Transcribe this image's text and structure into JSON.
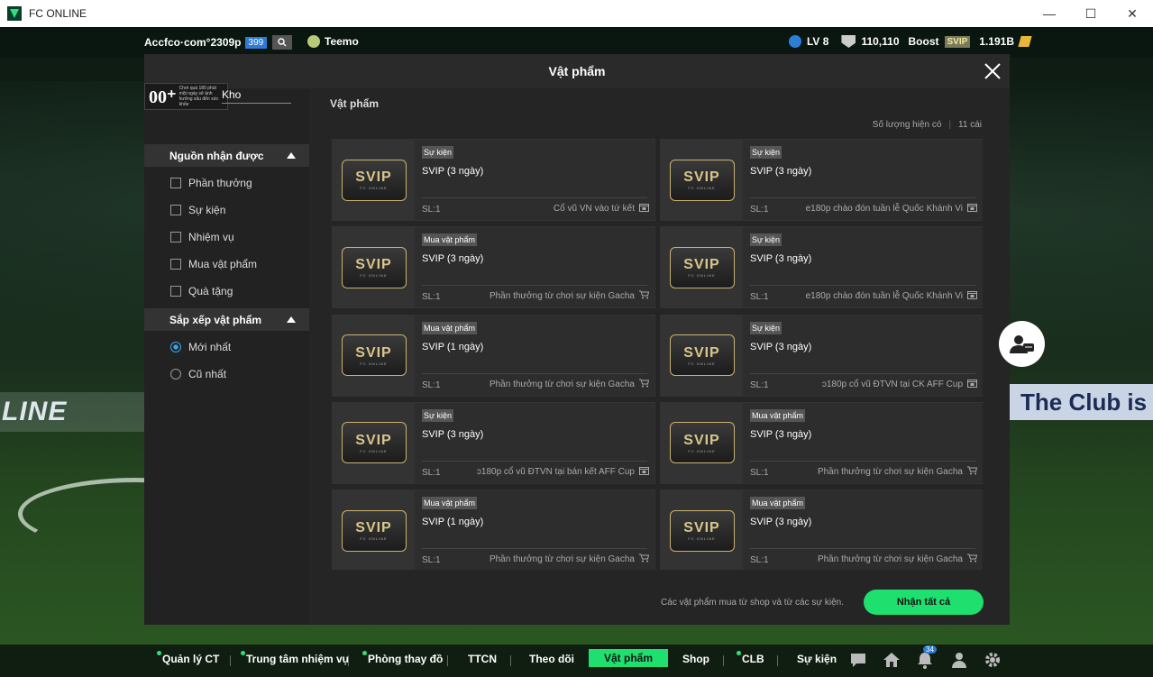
{
  "window": {
    "title": "FC ONLINE",
    "minimize": "—",
    "maximize": "☐",
    "close": "✕"
  },
  "topbar": {
    "username": "Accfco·com°2309p",
    "user_badge": "399",
    "team": "Teemo",
    "level": "LV 8",
    "ovr": "110,110",
    "boost_label": "Boost",
    "svip": "SVIP",
    "bp": "1.191B"
  },
  "background": {
    "banner_left": "LINE",
    "banner_right": "The Club is Y"
  },
  "modal": {
    "title": "Vật phẩm",
    "age_rating": "00⁺",
    "age_note": "Chơi quá 180 phút một ngày sẽ ảnh hưởng xấu đến sức khỏe",
    "storage_label": "Kho",
    "content_title": "Vật phẩm",
    "count_label": "Số lượng hiện có",
    "count_value": "11 cái",
    "source_section": "Nguồn nhận được",
    "source_filters": [
      {
        "label": "Phần thưởng",
        "checked": false
      },
      {
        "label": "Sự kiện",
        "checked": false
      },
      {
        "label": "Nhiệm vụ",
        "checked": false
      },
      {
        "label": "Mua vật phẩm",
        "checked": false
      },
      {
        "label": "Quà tặng",
        "checked": false
      }
    ],
    "sort_section": "Sắp xếp vật phẩm",
    "sort_options": [
      {
        "label": "Mới nhất",
        "selected": true
      },
      {
        "label": "Cũ nhất",
        "selected": false
      }
    ],
    "items": [
      {
        "tag": "Sự kiện",
        "name": "SVIP (3 ngày)",
        "qty": "SL:1",
        "source": "Cổ vũ VN vào tứ kết",
        "icon": "calendar-icon"
      },
      {
        "tag": "Sự kiện",
        "name": "SVIP (3 ngày)",
        "qty": "SL:1",
        "source": "e180p chào đón tuần lễ Quốc Khánh Vi",
        "icon": "calendar-icon"
      },
      {
        "tag": "Mua vật phẩm",
        "name": "SVIP (3 ngày)",
        "qty": "SL:1",
        "source": "Phần thưởng từ chơi sự kiện Gacha",
        "icon": "cart-icon"
      },
      {
        "tag": "Sự kiện",
        "name": "SVIP (3 ngày)",
        "qty": "SL:1",
        "source": "e180p chào đón tuần lễ Quốc Khánh Vi",
        "icon": "calendar-icon"
      },
      {
        "tag": "Mua vật phẩm",
        "name": "SVIP (1 ngày)",
        "qty": "SL:1",
        "source": "Phần thưởng từ chơi sự kiện Gacha",
        "icon": "cart-icon"
      },
      {
        "tag": "Sự kiện",
        "name": "SVIP (3 ngày)",
        "qty": "SL:1",
        "source": "ɔ180p cổ vũ ĐTVN tại CK AFF Cup",
        "icon": "calendar-icon"
      },
      {
        "tag": "Sự kiện",
        "name": "SVIP (3 ngày)",
        "qty": "SL:1",
        "source": "ɔ180p cổ vũ ĐTVN tại bán kết AFF Cup",
        "icon": "calendar-icon"
      },
      {
        "tag": "Mua vật phẩm",
        "name": "SVIP (3 ngày)",
        "qty": "SL:1",
        "source": "Phần thưởng từ chơi sự kiện Gacha",
        "icon": "cart-icon"
      },
      {
        "tag": "Mua vật phẩm",
        "name": "SVIP (1 ngày)",
        "qty": "SL:1",
        "source": "Phần thưởng từ chơi sự kiện Gacha",
        "icon": "cart-icon"
      },
      {
        "tag": "Mua vật phẩm",
        "name": "SVIP (3 ngày)",
        "qty": "SL:1",
        "source": "Phần thưởng từ chơi sự kiện Gacha",
        "icon": "cart-icon"
      }
    ],
    "item_logo_text": "SVIP",
    "item_logo_sub": "FC ONLINE",
    "footer_note": "Các vật phẩm mua từ shop và từ các sự kiện.",
    "claim_all": "Nhận tất cả"
  },
  "bottomnav": {
    "items": [
      {
        "label": "Quản lý CT",
        "dot": true
      },
      {
        "label": "Trung tâm nhiệm vụ",
        "dot": true
      },
      {
        "label": "Phòng thay đồ",
        "dot": true
      },
      {
        "label": "TTCN",
        "dot": false
      },
      {
        "label": "Theo dõi",
        "dot": false
      },
      {
        "label": "Vật phẩm",
        "dot": false,
        "active": true
      },
      {
        "label": "Shop",
        "dot": false
      },
      {
        "label": "CLB",
        "dot": true
      },
      {
        "label": "Sự kiện",
        "dot": false
      }
    ],
    "notification_count": "34",
    "accent": "#1fe06f"
  }
}
